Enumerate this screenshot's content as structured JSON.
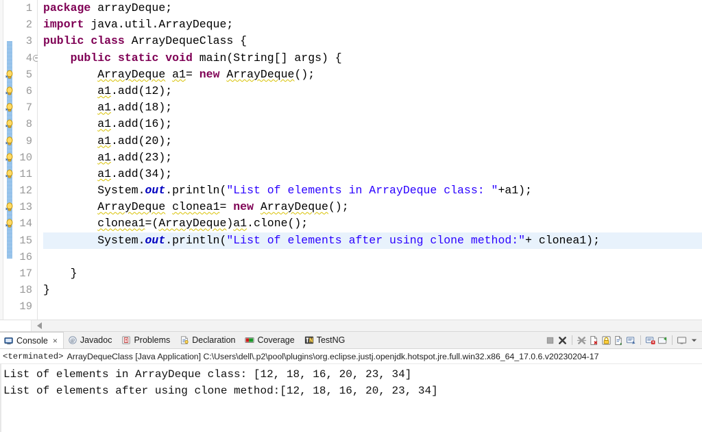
{
  "editor": {
    "name": "java-source-editor",
    "current_line": 15,
    "lines": [
      {
        "num": "1",
        "marker": "none",
        "fold": false,
        "text": "package arrayDeque;"
      },
      {
        "num": "2",
        "marker": "none",
        "fold": false,
        "text": "import java.util.ArrayDeque;"
      },
      {
        "num": "3",
        "marker": "none",
        "fold": false,
        "text": "public class ArrayDequeClass {"
      },
      {
        "num": "4",
        "marker": "none",
        "fold": true,
        "text": "    public static void main(String[] args) {"
      },
      {
        "num": "5",
        "marker": "warning",
        "fold": false,
        "text": "        ArrayDeque a1= new ArrayDeque();"
      },
      {
        "num": "6",
        "marker": "warning",
        "fold": false,
        "text": "        a1.add(12);"
      },
      {
        "num": "7",
        "marker": "warning",
        "fold": false,
        "text": "        a1.add(18);"
      },
      {
        "num": "8",
        "marker": "warning",
        "fold": false,
        "text": "        a1.add(16);"
      },
      {
        "num": "9",
        "marker": "warning",
        "fold": false,
        "text": "        a1.add(20);"
      },
      {
        "num": "10",
        "marker": "warning",
        "fold": false,
        "text": "        a1.add(23);"
      },
      {
        "num": "11",
        "marker": "warning",
        "fold": false,
        "text": "        a1.add(34);"
      },
      {
        "num": "12",
        "marker": "none",
        "fold": false,
        "text": "        System.out.println(\"List of elements in ArrayDeque class: \"+a1);"
      },
      {
        "num": "13",
        "marker": "warning",
        "fold": false,
        "text": "        ArrayDeque clonea1= new ArrayDeque();"
      },
      {
        "num": "14",
        "marker": "warning",
        "fold": false,
        "text": "        clonea1=(ArrayDeque)a1.clone();"
      },
      {
        "num": "15",
        "marker": "none",
        "fold": false,
        "text": "        System.out.println(\"List of elements after using clone method:\"+ clonea1);"
      },
      {
        "num": "16",
        "marker": "none",
        "fold": false,
        "text": ""
      },
      {
        "num": "17",
        "marker": "none",
        "fold": false,
        "text": "    }"
      },
      {
        "num": "18",
        "marker": "none",
        "fold": false,
        "text": "}"
      },
      {
        "num": "19",
        "marker": "none",
        "fold": false,
        "text": ""
      }
    ]
  },
  "bottom_panel": {
    "tabs": [
      {
        "label": "Console",
        "icon": "console-icon",
        "active": true,
        "closable": true
      },
      {
        "label": "Javadoc",
        "icon": "javadoc-icon",
        "active": false,
        "closable": false
      },
      {
        "label": "Problems",
        "icon": "problems-icon",
        "active": false,
        "closable": false
      },
      {
        "label": "Declaration",
        "icon": "declaration-icon",
        "active": false,
        "closable": false
      },
      {
        "label": "Coverage",
        "icon": "coverage-icon",
        "active": false,
        "closable": false
      },
      {
        "label": "TestNG",
        "icon": "testng-icon",
        "active": false,
        "closable": false
      }
    ],
    "close_glyph": "×",
    "toolbar": [
      {
        "name": "terminate-button",
        "icon": "stop-square-icon"
      },
      {
        "name": "terminate-all-button",
        "icon": "terminate-all-x-icon"
      },
      {
        "name": "remove-all-terminated-button",
        "icon": "remove-all-terminated-icon"
      },
      {
        "name": "clear-console-button",
        "icon": "clear-console-icon"
      },
      {
        "name": "scroll-lock-button",
        "icon": "scroll-lock-icon"
      },
      {
        "name": "word-wrap-button",
        "icon": "word-wrap-icon"
      },
      {
        "name": "show-console-on-output-button",
        "icon": "show-console-output-icon"
      },
      {
        "name": "show-console-on-error-button",
        "icon": "show-console-error-icon"
      },
      {
        "name": "pin-console-button",
        "icon": "pin-console-icon"
      },
      {
        "name": "display-selected-console-button",
        "icon": "display-console-icon"
      },
      {
        "name": "open-console-menu-button",
        "icon": "chevron-down-icon"
      }
    ],
    "status": {
      "state": "<terminated>",
      "launch": "ArrayDequeClass [Java Application] C:\\Users\\dell\\.p2\\pool\\plugins\\org.eclipse.justj.openjdk.hotspot.jre.full.win32.x86_64_17.0.6.v20230204-17"
    },
    "output": [
      "List of elements in ArrayDeque class: [12, 18, 16, 20, 23, 34]",
      "List of elements after using clone method:[12, 18, 16, 20, 23, 34]"
    ]
  },
  "colors": {
    "keyword": "#7f0055",
    "string": "#2a00ff",
    "field": "#0000c0",
    "line_number": "#999999",
    "current_line_bg": "#e8f2fc",
    "warning_underline": "#d8c100",
    "change_bar": "#8fc0e8"
  }
}
